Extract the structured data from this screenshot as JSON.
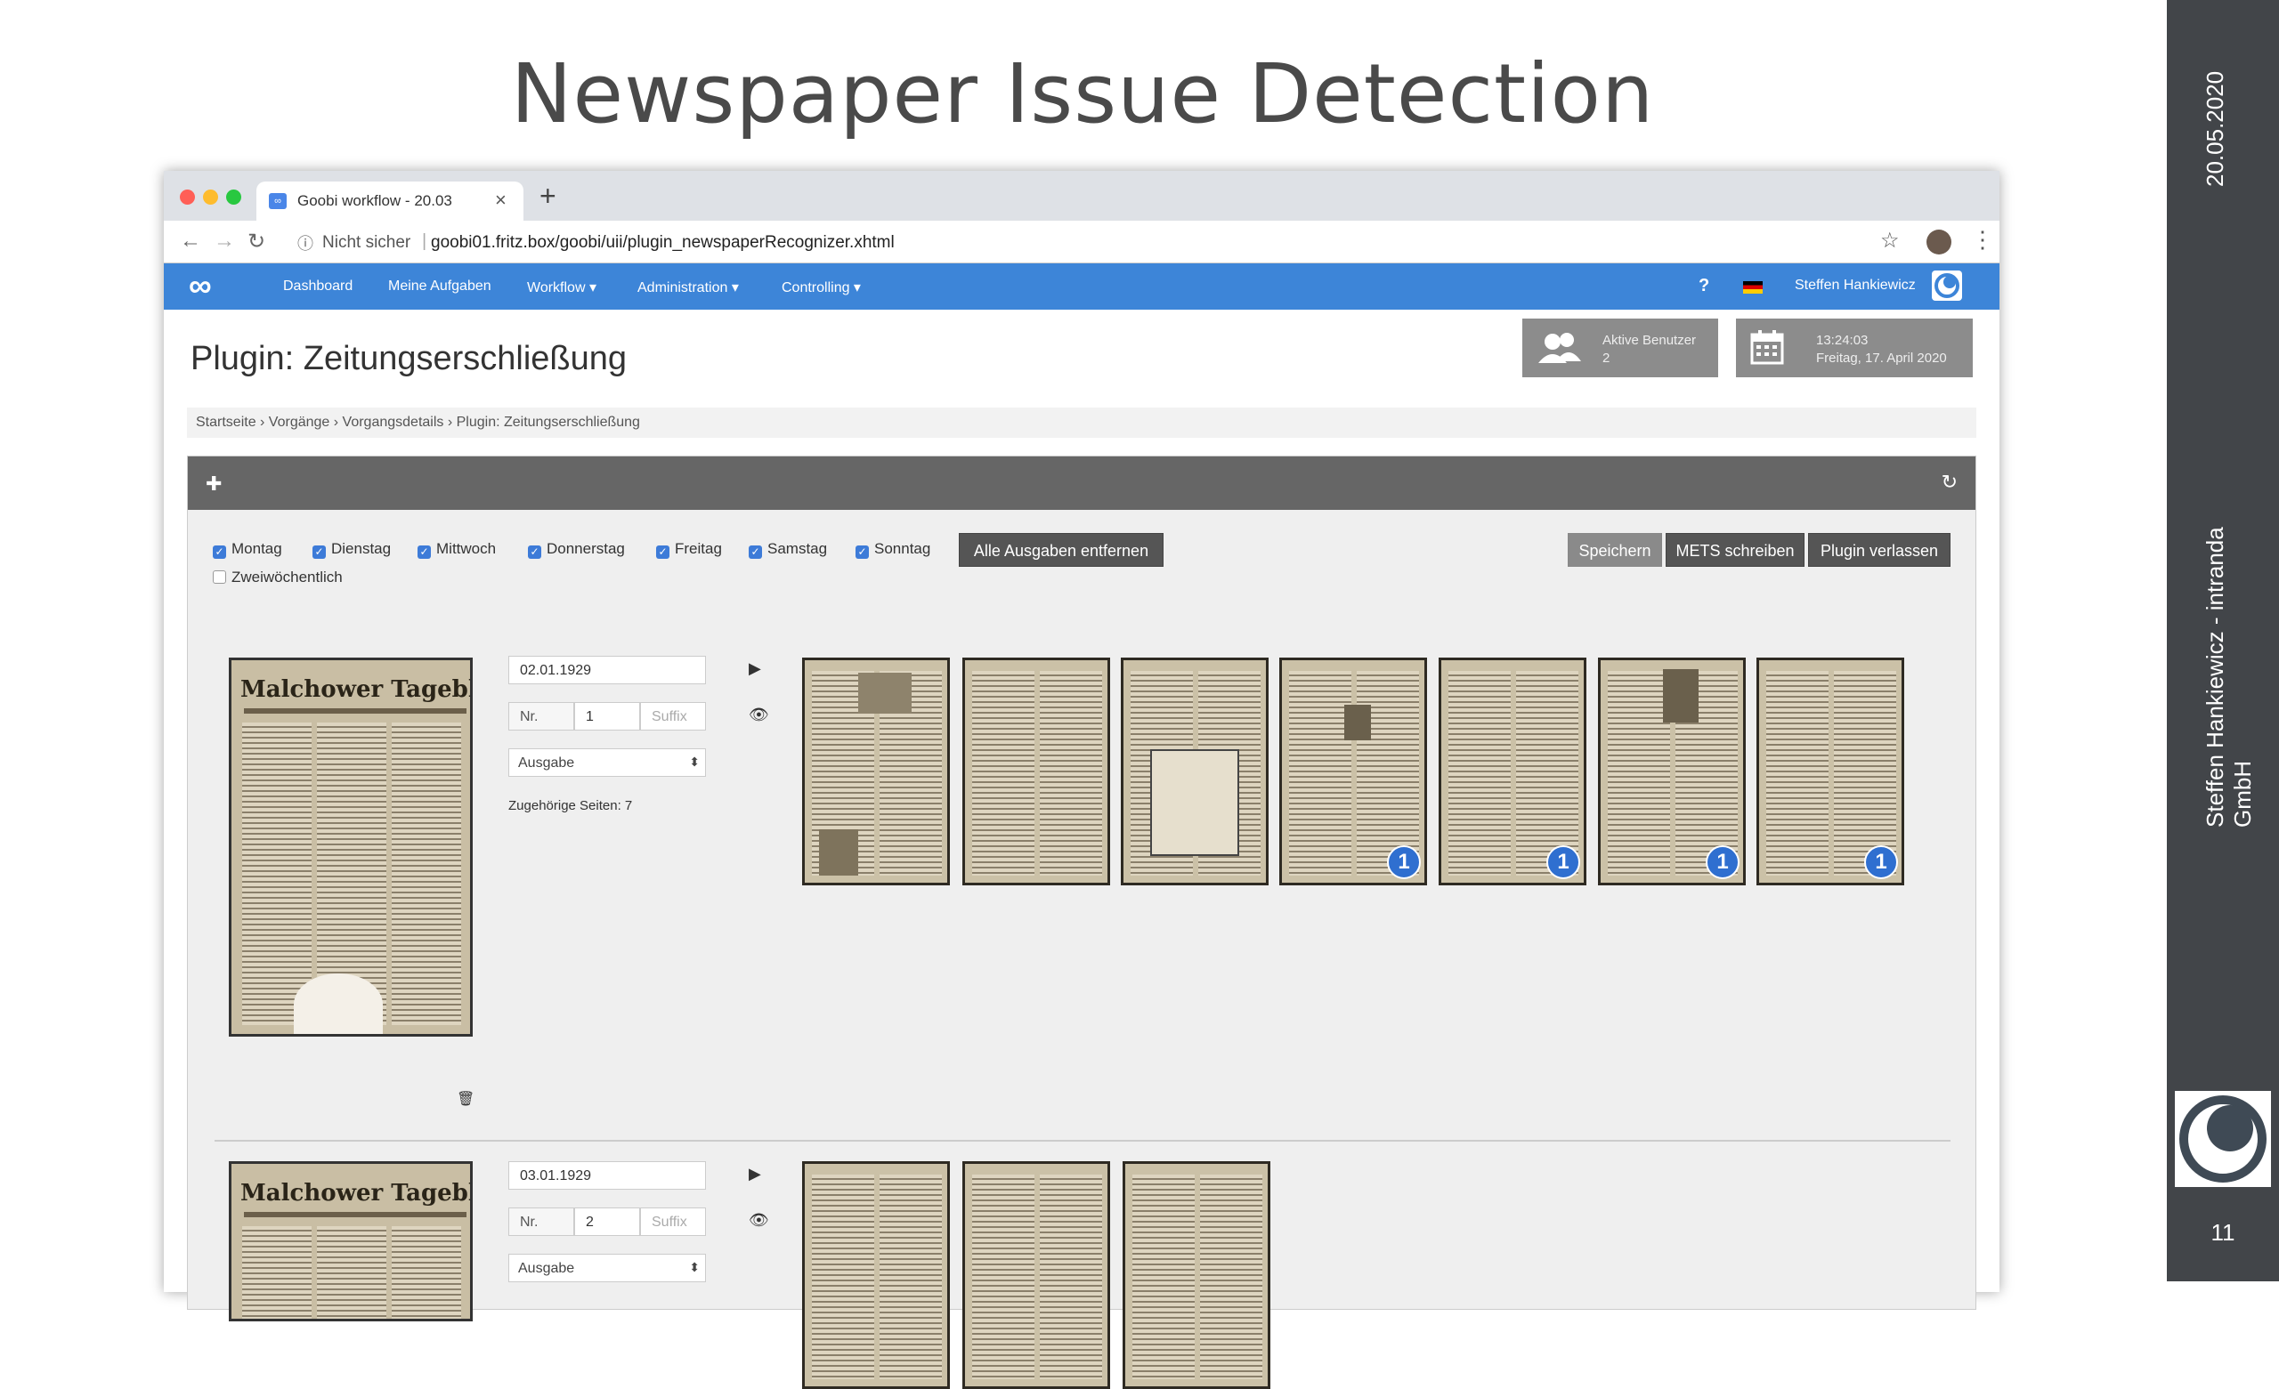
{
  "slide": {
    "title": "Newspaper Issue Detection",
    "date": "20.05.2020",
    "author": "Steffen Hankiewicz - intranda GmbH",
    "page_number": "11"
  },
  "browser": {
    "tab_title": "Goobi workflow - 20.03",
    "tab_favicon": "∞",
    "security_label": "Nicht sicher",
    "url": "goobi01.fritz.box/goobi/uii/plugin_newspaperRecognizer.xhtml"
  },
  "nav": {
    "items": [
      "Dashboard",
      "Meine Aufgaben",
      "Workflow ▾",
      "Administration ▾",
      "Controlling ▾"
    ],
    "help": "?",
    "user": "Steffen Hankiewicz"
  },
  "page": {
    "title": "Plugin: Zeitungserschließung",
    "active_users_label": "Aktive Benutzer",
    "active_users_count": "2",
    "time": "13:24:03",
    "date": "Freitag, 17. April 2020",
    "breadcrumb": "Startseite  ›  Vorgänge  ›  Vorgangsdetails  ›  Plugin: Zeitungserschließung"
  },
  "weekdays": [
    {
      "label": "Montag",
      "checked": true
    },
    {
      "label": "Dienstag",
      "checked": true
    },
    {
      "label": "Mittwoch",
      "checked": true
    },
    {
      "label": "Donnerstag",
      "checked": true
    },
    {
      "label": "Freitag",
      "checked": true
    },
    {
      "label": "Samstag",
      "checked": true
    },
    {
      "label": "Sonntag",
      "checked": true
    }
  ],
  "biweekly": {
    "label": "Zweiwöchentlich",
    "checked": false
  },
  "buttons": {
    "remove_all": "Alle Ausgaben entfernen",
    "save": "Speichern",
    "write_mets": "METS schreiben",
    "leave": "Plugin verlassen"
  },
  "issues": [
    {
      "date": "02.01.1929",
      "nr_label": "Nr.",
      "nr": "1",
      "suffix_placeholder": "Suffix",
      "type": "Ausgabe",
      "pages_text": "Zugehörige Seiten: 7",
      "masthead": "Malchower Tageblatt",
      "page_badges": [
        "",
        "",
        "",
        "1",
        "1",
        "1",
        "1"
      ]
    },
    {
      "date": "03.01.1929",
      "nr_label": "Nr.",
      "nr": "2",
      "suffix_placeholder": "Suffix",
      "type": "Ausgabe",
      "masthead": "Malchower Tageblatt",
      "page_badges": [
        "",
        "",
        ""
      ]
    }
  ]
}
